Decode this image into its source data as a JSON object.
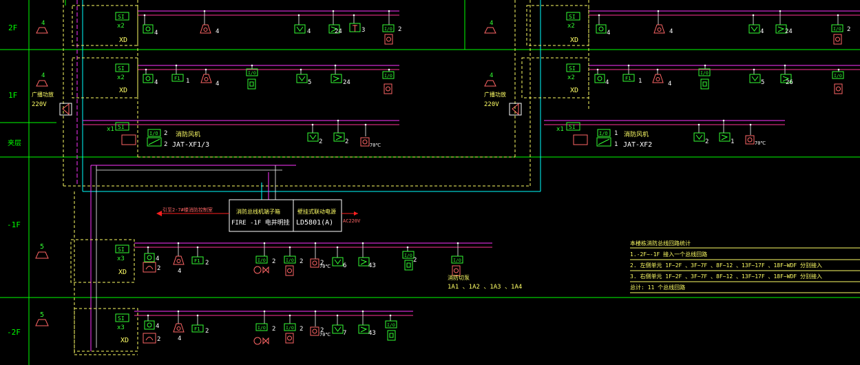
{
  "floors": {
    "f2": "2F",
    "f1": "1F",
    "roof": "夹层",
    "b1": "-1F",
    "b2": "-2F"
  },
  "colors": {
    "bg": "#000000",
    "frame": "#00ff00",
    "bus": "#ff33ff",
    "bus2": "#ff3399",
    "trunk": "#00ffff",
    "box": "#ffff66",
    "device_green": "#33ff33",
    "device_red": "#ff6666",
    "white": "#ffffff",
    "red_line": "#ff2020"
  },
  "labels": {
    "si": "SI",
    "xd": "XD",
    "x1": "x1",
    "x2": "x2",
    "x3": "x3",
    "io": "I/O",
    "io_short": "I/O",
    "f1": "F1",
    "broadcast": "广播功放",
    "v220": "220V",
    "fan_title": "消防风机",
    "fan_left_model": "JAT-XF1/3",
    "fan_right_model": "JAT-XF2",
    "temp70": "70℃",
    "count_2": "2",
    "count_4": "4",
    "count_5": "5",
    "count_6": "6",
    "count_7": "7",
    "count_24": "24",
    "count_26": "26",
    "count_43": "43",
    "count_3": "3",
    "count_1": "1",
    "panel_left_title": "消防总线机端子箱",
    "panel_left_sub": "FIRE -1F 电井明挂",
    "panel_right_title": "壁挂式联动电源",
    "panel_right_sub": "LD5801(A)",
    "ac220": "AC220V",
    "link_text": "引至2-7#楼消防控制室",
    "pump_title": "消防切泵",
    "pump_codes": "1A1 、1A2 、1A3 、1A4"
  },
  "notes": {
    "title": "本楼栋消防总线回路统计",
    "line1": "1.-2F~-1F      接入一个总线回路",
    "line2": "2. 左侧单元 1F~2F  、3F~7F  、8F~12  、13F~17F  、18F~WDF     分别接入",
    "line3": "3. 右侧单元 1F~2F  、3F~7F  、8F~12  、13F~17F  、18F~WDF     分别接入",
    "total": "总计: 11  个总线回路"
  }
}
